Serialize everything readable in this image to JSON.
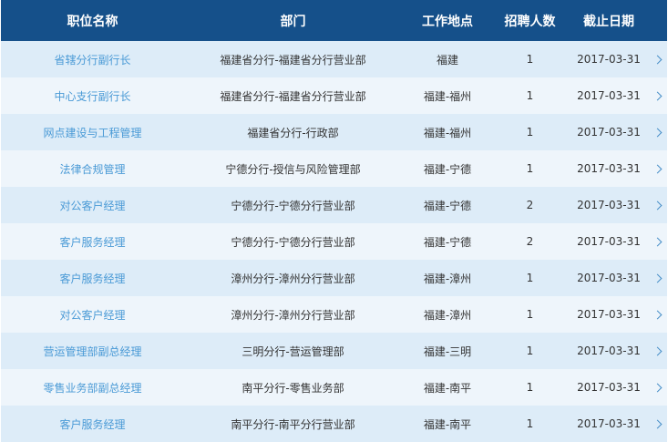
{
  "header": {
    "title": "职位名称",
    "department": "部门",
    "location": "工作地点",
    "headcount": "招聘人数",
    "deadline": "截止日期"
  },
  "rows": [
    {
      "title": "省辖分行副行长",
      "department": "福建省分行-福建省分行营业部",
      "location": "福建",
      "headcount": "1",
      "deadline": "2017-03-31"
    },
    {
      "title": "中心支行副行长",
      "department": "福建省分行-福建省分行营业部",
      "location": "福建-福州",
      "headcount": "1",
      "deadline": "2017-03-31"
    },
    {
      "title": "网点建设与工程管理",
      "department": "福建省分行-行政部",
      "location": "福建-福州",
      "headcount": "1",
      "deadline": "2017-03-31"
    },
    {
      "title": "法律合规管理",
      "department": "宁德分行-授信与风险管理部",
      "location": "福建-宁德",
      "headcount": "1",
      "deadline": "2017-03-31"
    },
    {
      "title": "对公客户经理",
      "department": "宁德分行-宁德分行营业部",
      "location": "福建-宁德",
      "headcount": "2",
      "deadline": "2017-03-31"
    },
    {
      "title": "客户服务经理",
      "department": "宁德分行-宁德分行营业部",
      "location": "福建-宁德",
      "headcount": "2",
      "deadline": "2017-03-31"
    },
    {
      "title": "客户服务经理",
      "department": "漳州分行-漳州分行营业部",
      "location": "福建-漳州",
      "headcount": "1",
      "deadline": "2017-03-31"
    },
    {
      "title": "对公客户经理",
      "department": "漳州分行-漳州分行营业部",
      "location": "福建-漳州",
      "headcount": "1",
      "deadline": "2017-03-31"
    },
    {
      "title": "营运管理部副总经理",
      "department": "三明分行-营运管理部",
      "location": "福建-三明",
      "headcount": "1",
      "deadline": "2017-03-31"
    },
    {
      "title": "零售业务部副总经理",
      "department": "南平分行-零售业务部",
      "location": "福建-南平",
      "headcount": "1",
      "deadline": "2017-03-31"
    },
    {
      "title": "客户服务经理",
      "department": "南平分行-南平分行营业部",
      "location": "福建-南平",
      "headcount": "1",
      "deadline": "2017-03-31"
    }
  ],
  "icons": {
    "row_arrow": "chevron-right-icon"
  },
  "colors": {
    "header_bg": "#15508a",
    "row_odd": "#ddecf8",
    "row_even": "#eef5fb",
    "link": "#4a9ad6"
  }
}
